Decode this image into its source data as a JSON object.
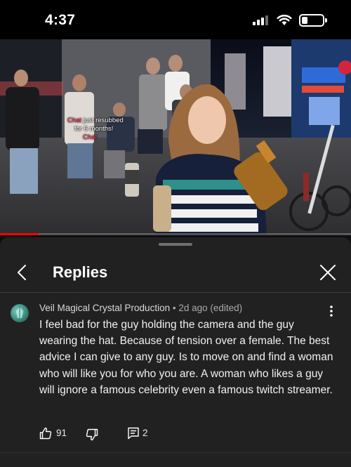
{
  "status_bar": {
    "time": "4:37",
    "icons": [
      "signal-icon",
      "wifi-icon",
      "battery-icon"
    ]
  },
  "video": {
    "overlay_lines": [
      {
        "prefix": "Chat",
        "text": " just resubbed"
      },
      {
        "prefix": "for ",
        "text": "6 months!"
      },
      {
        "prefix": "",
        "text": "Chat"
      }
    ],
    "progress": 0.11,
    "progress_color": "#ff0000"
  },
  "sheet": {
    "title": "Replies",
    "back_icon": "back-arrow-icon",
    "close_icon": "close-icon"
  },
  "comment": {
    "author": "Veil Magical Crystal Production",
    "separator": " • ",
    "time": "2d ago (edited)",
    "body": "I feel bad for the guy holding the camera and the guy wearing the hat. Because of tension over a female. The best advice I can give to any guy. Is to move on and find a woman who will like you for who you are. A woman who likes a guy will ignore a famous celebrity even a famous twitch streamer.",
    "like_count": "91",
    "reply_count": "2"
  },
  "colors": {
    "background": "#0f0f0f",
    "sheet": "#212121",
    "accent_red": "#ff0000"
  }
}
